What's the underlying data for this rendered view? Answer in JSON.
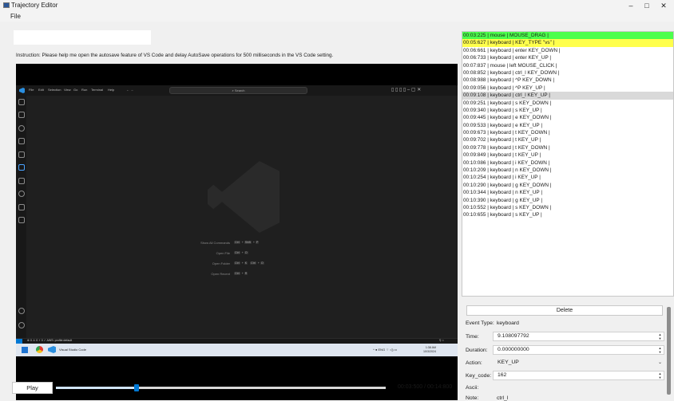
{
  "window": {
    "title": "Trajectory Editor",
    "minimize": "–",
    "maximize": "□",
    "close": "✕"
  },
  "menu": {
    "file": "File"
  },
  "instruction": "Instruction: Please help me open the autosave feature of VS Code and delay AutoSave operations for 500 milliseconds in the VS Code setting.",
  "vscode": {
    "menus": [
      "File",
      "Edit",
      "Selection",
      "View",
      "Go",
      "Run",
      "Terminal",
      "Help"
    ],
    "nav_arrows": "← →",
    "search": "⌕ Search",
    "title_buttons": "▯ ▯ ▯ ▯   –   ▢   ✕",
    "commands": [
      {
        "label": "Show All Commands",
        "keys": [
          "Ctrl",
          "+",
          "Shift",
          "+",
          "P"
        ]
      },
      {
        "label": "Open File",
        "keys": [
          "Ctrl",
          "+",
          "O"
        ]
      },
      {
        "label": "Open Folder",
        "keys": [
          "Ctrl",
          "+",
          "K",
          "Ctrl",
          "+",
          "O"
        ]
      },
      {
        "label": "Open Recent",
        "keys": [
          "Ctrl",
          "+",
          "R"
        ]
      }
    ],
    "status_left": "⊗ 0 ⚠ 0   ⚡ 0   ✓ AWS: profile:default",
    "status_right": "⚲  ⌂"
  },
  "taskbar": {
    "app_label": "Visual Studio Code",
    "tray": "^  ●  ENG  ⌔  ◁)  ▭",
    "time": "1:38 AM",
    "date": "10/3/2024"
  },
  "player": {
    "play_label": "Play",
    "progress_fraction": 0.244,
    "time_label": "00:03:500 / 00:14:800"
  },
  "events": [
    {
      "text": "00:03:225 | mouse     | MOUSE_DRAG |",
      "highlight": "#4cff4c"
    },
    {
      "text": "00:05:627 | keyboard  | KEY_TYPE \"vs\" |",
      "highlight": "#ffff4c"
    },
    {
      "text": "00:06:661 | keyboard  | enter KEY_DOWN |",
      "highlight": ""
    },
    {
      "text": "00:06:733 | keyboard  | enter KEY_UP |",
      "highlight": ""
    },
    {
      "text": "00:07:837 | mouse     | left MOUSE_CLICK |",
      "highlight": ""
    },
    {
      "text": "00:08:852 | keyboard  | ctrl_l KEY_DOWN |",
      "highlight": ""
    },
    {
      "text": "00:08:988 | keyboard  | ^P KEY_DOWN |",
      "highlight": ""
    },
    {
      "text": "00:09:056 | keyboard  | ^P KEY_UP |",
      "highlight": ""
    },
    {
      "text": "00:09:108 | keyboard  | ctrl_l KEY_UP |",
      "highlight": "#d9d9d9"
    },
    {
      "text": "00:09:251 | keyboard  | s KEY_DOWN |",
      "highlight": ""
    },
    {
      "text": "00:09:340 | keyboard  | s KEY_UP |",
      "highlight": ""
    },
    {
      "text": "00:09:445 | keyboard  | e KEY_DOWN |",
      "highlight": ""
    },
    {
      "text": "00:09:533 | keyboard  | e KEY_UP |",
      "highlight": ""
    },
    {
      "text": "00:09:673 | keyboard  | t KEY_DOWN |",
      "highlight": ""
    },
    {
      "text": "00:09:702 | keyboard  | t KEY_UP |",
      "highlight": ""
    },
    {
      "text": "00:09:778 | keyboard  | t KEY_DOWN |",
      "highlight": ""
    },
    {
      "text": "00:09:849 | keyboard  | t KEY_UP |",
      "highlight": ""
    },
    {
      "text": "00:10:086 | keyboard  | i KEY_DOWN |",
      "highlight": ""
    },
    {
      "text": "00:10:209 | keyboard  | n KEY_DOWN |",
      "highlight": ""
    },
    {
      "text": "00:10:254 | keyboard  | i KEY_UP |",
      "highlight": ""
    },
    {
      "text": "00:10:290 | keyboard  | g KEY_DOWN |",
      "highlight": ""
    },
    {
      "text": "00:10:344 | keyboard  | n KEY_UP |",
      "highlight": ""
    },
    {
      "text": "00:10:390 | keyboard  | g KEY_UP |",
      "highlight": ""
    },
    {
      "text": "00:10:552 | keyboard  | s KEY_DOWN |",
      "highlight": ""
    },
    {
      "text": "00:10:655 | keyboard  | s KEY_UP |",
      "highlight": ""
    }
  ],
  "detail": {
    "delete_label": "Delete",
    "event_type_label": "Event Type:",
    "event_type_value": "keyboard",
    "time_label": "Time:",
    "time_value": "9.108097792",
    "duration_label": "Duration:",
    "duration_value": "0.000000000",
    "action_label": "Action:",
    "action_value": "KEY_UP",
    "keycode_label": "Key_code:",
    "keycode_value": "162",
    "ascii_label": "Ascii:",
    "note_label": "Note:",
    "note_value": "ctrl_l"
  },
  "colors": {
    "accent": "#0078d4",
    "highlight_green": "#4cff4c",
    "highlight_yellow": "#ffff4c"
  }
}
